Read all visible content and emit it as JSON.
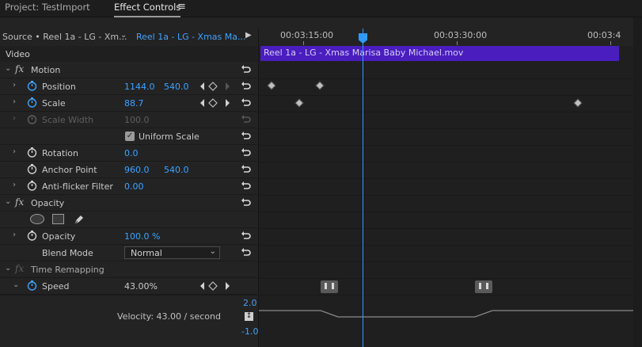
{
  "tabs": {
    "project": "Project: TestImport",
    "effect_controls": "Effect Controls"
  },
  "source": {
    "label": "Source • Reel 1a - LG - Xm...",
    "clip": "Reel 1a - LG - Xmas Ma..."
  },
  "ruler": {
    "t1": "00:03:15:00",
    "t2": "00:03:30:00",
    "t3": "00:03:4"
  },
  "clip_name": "Reel 1a - LG - Xmas Marisa Baby Michael.mov",
  "video_header": "Video",
  "motion": {
    "label": "Motion",
    "position": {
      "label": "Position",
      "x": "1144.0",
      "y": "540.0"
    },
    "scale": {
      "label": "Scale",
      "value": "88.7"
    },
    "scale_width": {
      "label": "Scale Width",
      "value": "100.0"
    },
    "uniform_scale": "Uniform Scale",
    "rotation": {
      "label": "Rotation",
      "value": "0.0"
    },
    "anchor": {
      "label": "Anchor Point",
      "x": "960.0",
      "y": "540.0"
    },
    "antiflicker": {
      "label": "Anti-flicker Filter",
      "value": "0.00"
    }
  },
  "opacity": {
    "label": "Opacity",
    "opacity": {
      "label": "Opacity",
      "value": "100.0 %"
    },
    "blend": {
      "label": "Blend Mode",
      "value": "Normal"
    }
  },
  "time_remap": {
    "label": "Time Remapping",
    "speed": {
      "label": "Speed",
      "value": "43.00%"
    },
    "velocity": "Velocity: 43.00 / second",
    "max": "2.0",
    "min": "-1.0"
  },
  "colors": {
    "accent": "#3ea2ff",
    "clip": "#4a1dbf",
    "playhead": "#2e9bff"
  }
}
